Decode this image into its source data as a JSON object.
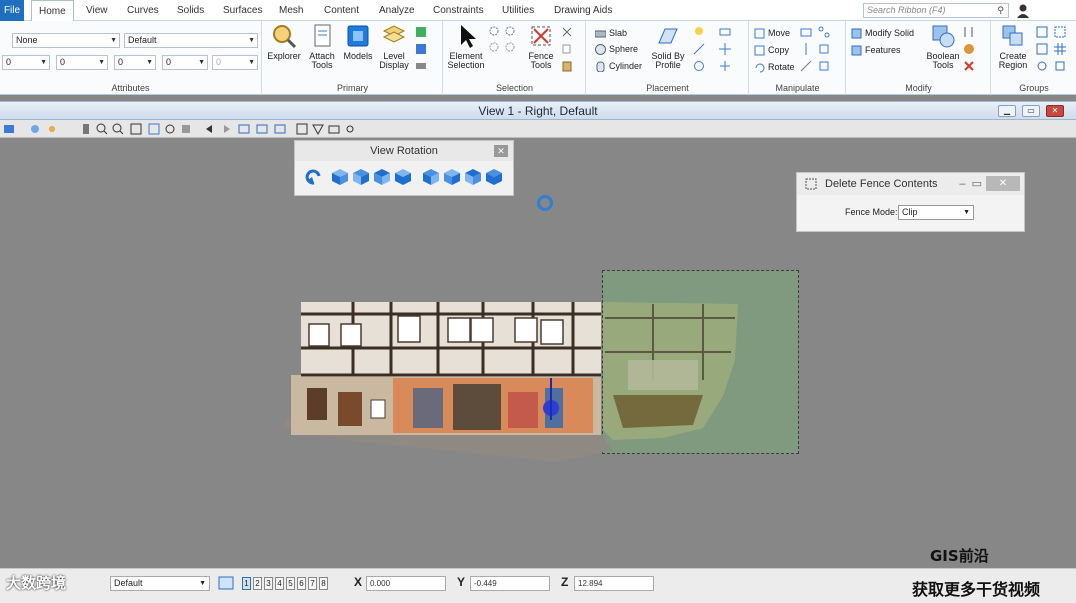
{
  "tabs": {
    "file": "File",
    "items": [
      "Home",
      "View",
      "Curves",
      "Solids",
      "Surfaces",
      "Mesh",
      "Content",
      "Analyze",
      "Constraints",
      "Utilities",
      "Drawing Aids"
    ]
  },
  "search": {
    "placeholder": "Search Ribbon (F4)"
  },
  "attributes": {
    "level": "None",
    "style": "Default",
    "color": "0",
    "line_style": "0",
    "weight": "0",
    "transparency": "0",
    "priority": "0",
    "title": "Attributes"
  },
  "primary": {
    "title": "Primary",
    "explorer": "Explorer",
    "attach_tools": "Attach Tools",
    "models": "Models",
    "level_display": "Level Display"
  },
  "selection": {
    "title": "Selection",
    "element_selection": "Element Selection",
    "fence_tools": "Fence Tools"
  },
  "placement": {
    "title": "Placement",
    "slab": "Slab",
    "sphere": "Sphere",
    "cylinder": "Cylinder",
    "solid_by_profile": "Solid By Profile"
  },
  "manipulate": {
    "title": "Manipulate",
    "move": "Move",
    "copy": "Copy",
    "rotate": "Rotate"
  },
  "modify": {
    "title": "Modify",
    "modify_solid": "Modify Solid",
    "features": "Features",
    "boolean_tools": "Boolean Tools"
  },
  "groups": {
    "title": "Groups",
    "create_region": "Create Region"
  },
  "view_window": {
    "title": "View 1 - Right, Default"
  },
  "view_rotation": {
    "title": "View Rotation"
  },
  "delete_fence": {
    "title": "Delete Fence Contents",
    "mode_label": "Fence Mode:",
    "mode_value": "Clip"
  },
  "status": {
    "level": "Default",
    "views": [
      "1",
      "2",
      "3",
      "4",
      "5",
      "6",
      "7",
      "8"
    ],
    "active_view": "1",
    "x_label": "X",
    "x_value": "0.000",
    "y_label": "Y",
    "y_value": "-0.449",
    "z_label": "Z",
    "z_value": "12.894"
  },
  "watermarks": {
    "left": "大数跨境",
    "right_top": "GIS前沿",
    "right_bottom": "获取更多干货视频"
  },
  "colors": {
    "accent": "#1e6fc0",
    "fence": "#78aa78",
    "viewport": "#878787"
  }
}
